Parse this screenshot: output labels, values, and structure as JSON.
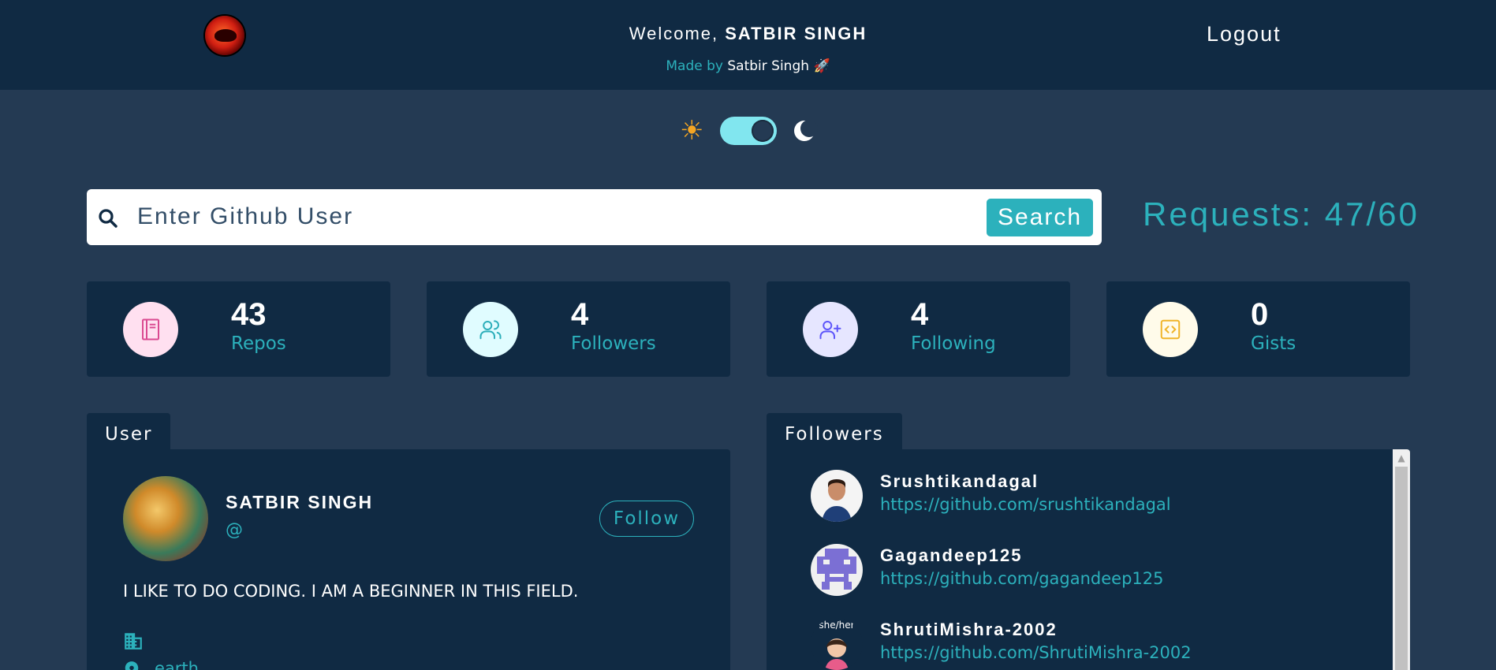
{
  "header": {
    "welcome_prefix": "Welcome, ",
    "welcome_name": "SATBIR SINGH",
    "made_by_prefix": "Made by ",
    "made_by_name": "Satbir Singh",
    "made_by_emoji": "🚀",
    "logout_label": "Logout"
  },
  "theme": {
    "mode": "dark",
    "sun_icon": "sun-icon",
    "moon_icon": "moon-icon"
  },
  "search": {
    "placeholder": "Enter Github User",
    "value": "",
    "button_label": "Search",
    "requests_text": "Requests: 47/60"
  },
  "stats": [
    {
      "value": "43",
      "label": "Repos",
      "icon": "book-icon",
      "color": "#da4a91",
      "bg": "#ffe0f0"
    },
    {
      "value": "4",
      "label": "Followers",
      "icon": "users-icon",
      "color": "#2caeba",
      "bg": "#e0fcff"
    },
    {
      "value": "4",
      "label": "Following",
      "icon": "user-plus-icon",
      "color": "#5d55fa",
      "bg": "#e6e6ff"
    },
    {
      "value": "0",
      "label": "Gists",
      "icon": "code-icon",
      "color": "#f0b429",
      "bg": "#fffbea"
    }
  ],
  "user_panel": {
    "tab_label": "User",
    "name": "SATBIR SINGH",
    "handle": "@",
    "follow_label": "Follow",
    "bio": "I LIKE TO DO CODING. I AM A BEGINNER IN THIS FIELD.",
    "company": "",
    "location": "earth"
  },
  "followers_panel": {
    "tab_label": "Followers",
    "items": [
      {
        "login": "Srushtikandagal",
        "url": "https://github.com/srushtikandagal"
      },
      {
        "login": "Gagandeep125",
        "url": "https://github.com/gagandeep125"
      },
      {
        "login": "ShrutiMishra-2002",
        "url": "https://github.com/ShrutiMishra-2002",
        "avatar_text": "she/her"
      }
    ]
  },
  "colors": {
    "primary": "#2cb1bc",
    "header_bg": "#102a43",
    "page_bg": "#243a53"
  }
}
